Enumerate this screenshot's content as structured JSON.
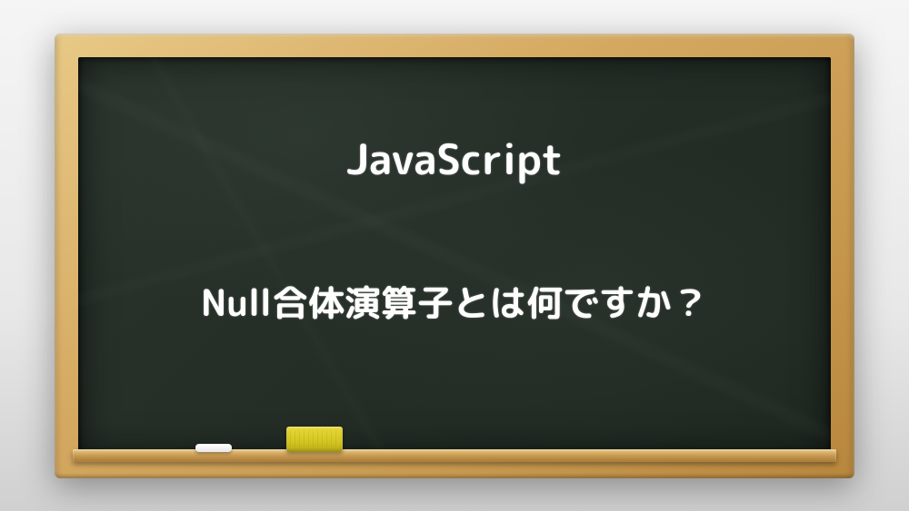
{
  "title": "JavaScript",
  "subtitle": "Null合体演算子とは何ですか？"
}
